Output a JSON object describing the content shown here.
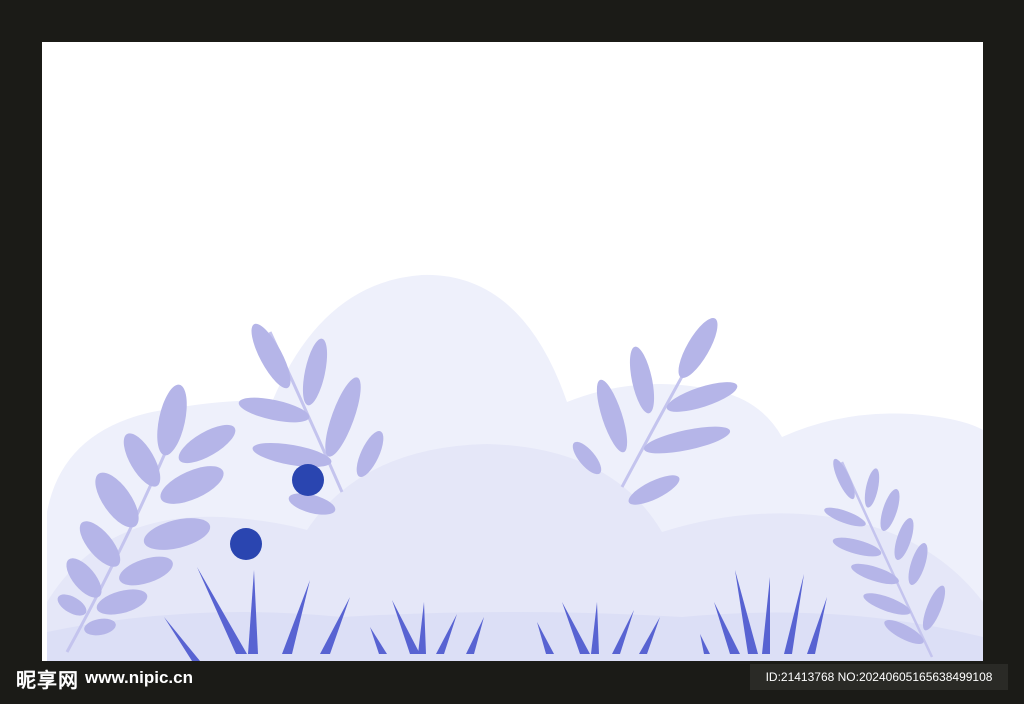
{
  "watermark": {
    "site_name": "昵享网",
    "site_url": "www.nipic.cn",
    "id_text": "ID:21413768 NO:20240605165638499108"
  },
  "colors": {
    "frame": "#1b1b17",
    "canvas": "#ffffff",
    "bush_back": "#eef0fb",
    "bush_mid": "#e5e7f8",
    "bush_front": "#dcdff6",
    "leaf": "#b5b5e8",
    "stem": "#c4c4ee",
    "grass": "#5863d2",
    "berry": "#2a45b0"
  },
  "icons": [
    "leafy-branch-icon",
    "grass-tuft-icon",
    "berry-dot-icon",
    "bush-mound-icon"
  ]
}
